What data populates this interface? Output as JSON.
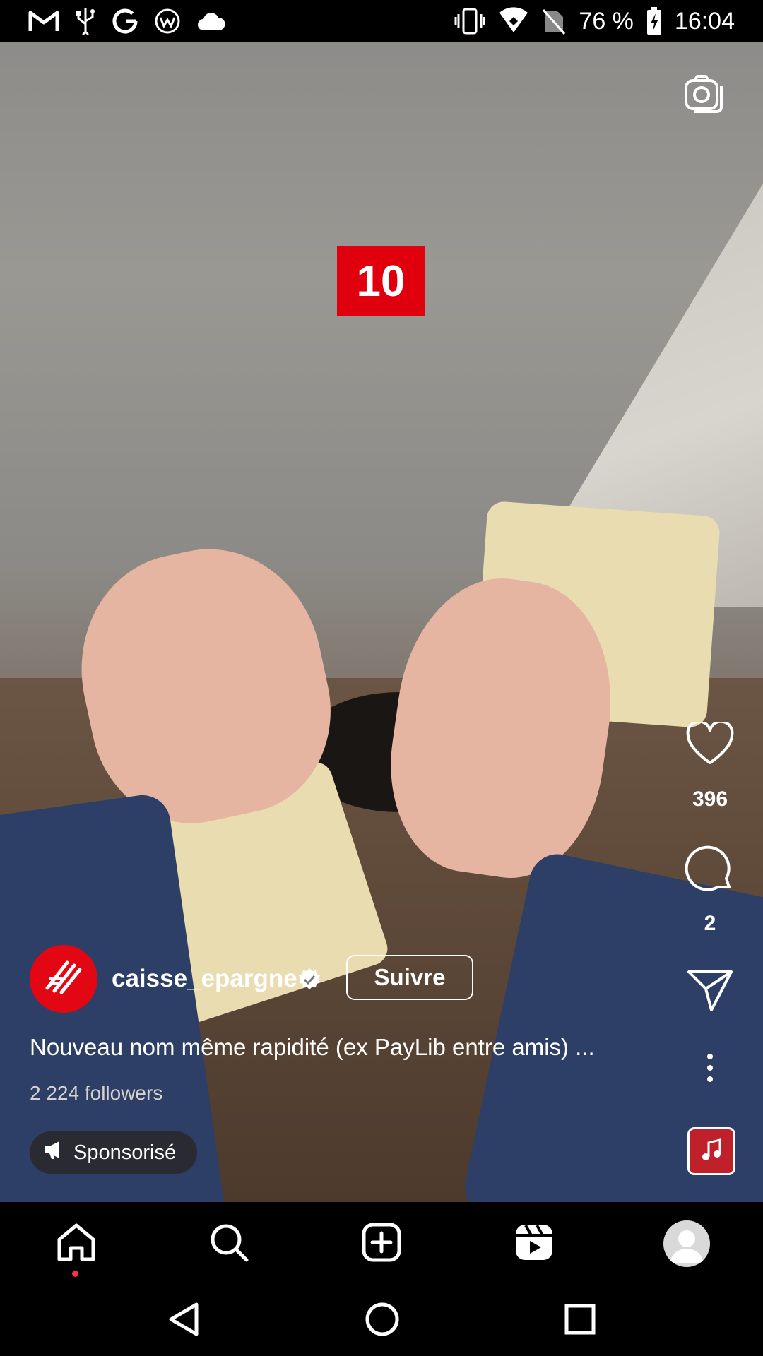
{
  "status_bar": {
    "battery": "76 %",
    "time": "16:04",
    "left_icons": [
      "gmail-icon",
      "usb-icon",
      "google-icon",
      "app-icon",
      "cloud-icon"
    ],
    "right_icons": [
      "vibrate-icon",
      "wifi-icon",
      "no-sim-icon",
      "battery-charging-icon"
    ]
  },
  "video": {
    "overlay_badge": "10"
  },
  "actions": {
    "likes": "396",
    "comments": "2"
  },
  "post": {
    "username": "caisse_epargne",
    "follow_label": "Suivre",
    "caption": "Nouveau nom même rapidité (ex PayLib entre amis) ...",
    "followers": "2 224 followers",
    "sponsored_label": "Sponsorisé"
  },
  "bottom_nav": {
    "items": [
      "home-icon",
      "search-icon",
      "create-icon",
      "reels-icon",
      "profile-avatar"
    ],
    "active": "home-icon"
  },
  "colors": {
    "brand_red": "#e30613",
    "badge_red": "#e0000d",
    "notification_dot": "#ff3040"
  }
}
